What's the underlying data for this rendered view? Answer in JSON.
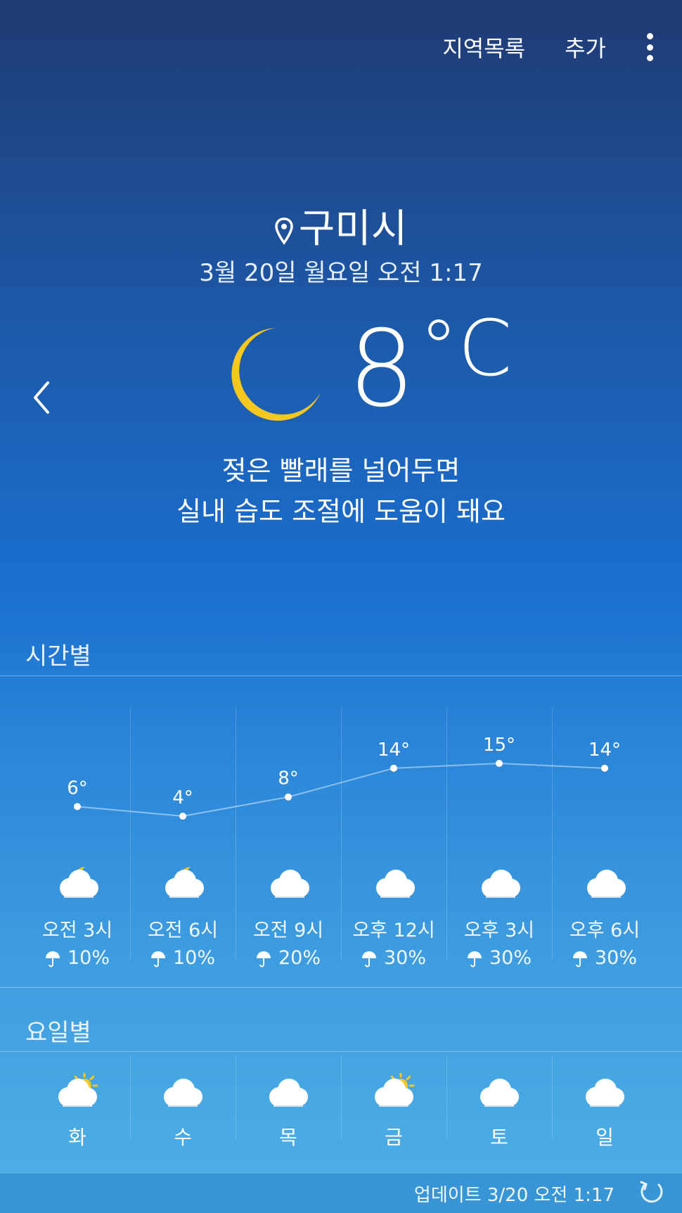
{
  "topbar": {
    "region_list": "지역목록",
    "add": "추가"
  },
  "location": "구미시",
  "datetime": "3월 20일 월요일 오전 1:17",
  "current": {
    "temp": "8",
    "unit": "°C",
    "icon": "crescent-moon-icon"
  },
  "message": {
    "line1": "젖은 빨래를 널어두면",
    "line2": "실내 습도 조절에 도움이 돼요"
  },
  "hourly_label": "시간별",
  "hourly": [
    {
      "temp": "6°",
      "time": "오전 3시",
      "rain": "10%",
      "icon": "cloud-moon-icon"
    },
    {
      "temp": "4°",
      "time": "오전 6시",
      "rain": "10%",
      "icon": "cloud-moon-icon"
    },
    {
      "temp": "8°",
      "time": "오전 9시",
      "rain": "20%",
      "icon": "cloud-icon"
    },
    {
      "temp": "14°",
      "time": "오후 12시",
      "rain": "30%",
      "icon": "cloud-icon"
    },
    {
      "temp": "15°",
      "time": "오후 3시",
      "rain": "30%",
      "icon": "cloud-icon"
    },
    {
      "temp": "14°",
      "time": "오후 6시",
      "rain": "30%",
      "icon": "cloud-icon"
    }
  ],
  "daily_label": "요일별",
  "daily": [
    {
      "day": "화",
      "icon": "cloud-sun-icon"
    },
    {
      "day": "수",
      "icon": "cloud-icon"
    },
    {
      "day": "목",
      "icon": "cloud-icon"
    },
    {
      "day": "금",
      "icon": "cloud-sun-icon"
    },
    {
      "day": "토",
      "icon": "cloud-icon"
    },
    {
      "day": "일",
      "icon": "cloud-icon"
    }
  ],
  "footer": {
    "updated": "업데이트 3/20  오전 1:17"
  },
  "colors": {
    "moon": "#f6c81f",
    "cloud": "#ffffff",
    "sun": "#f6c81f"
  }
}
